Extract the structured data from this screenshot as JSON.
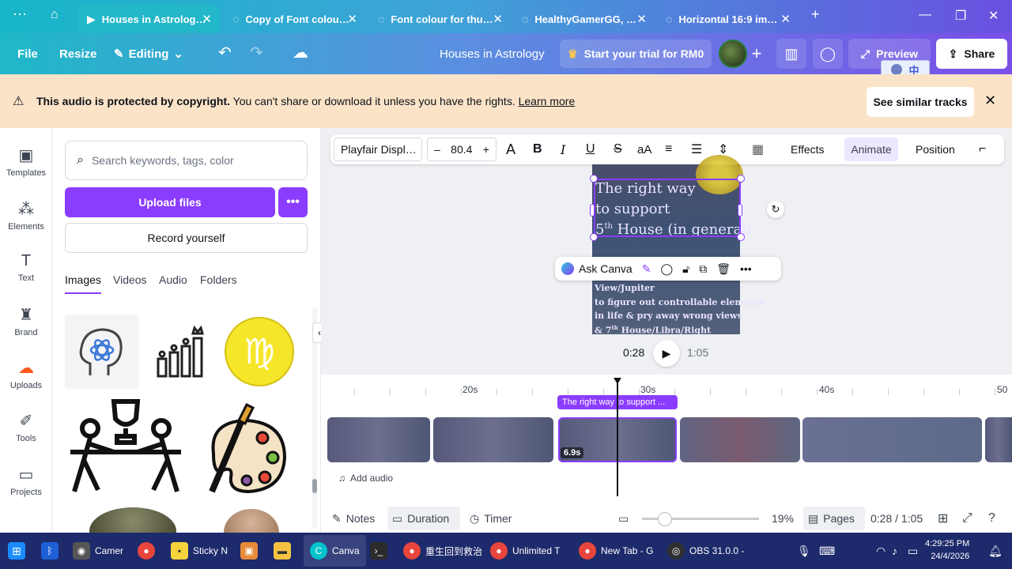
{
  "browser": {
    "tabs": [
      {
        "label": "Houses in Astrolog…",
        "active": true
      },
      {
        "label": "Copy of Font colou…",
        "active": false
      },
      {
        "label": "Font colour for thu…",
        "active": false
      },
      {
        "label": "HealthyGamerGG, …",
        "active": false
      },
      {
        "label": "Horizontal 16:9 im…",
        "active": false
      }
    ],
    "new_tab": "+"
  },
  "header": {
    "file": "File",
    "resize": "Resize",
    "editing": "Editing",
    "doc_title": "Houses in Astrology",
    "trial": "Start your trial for RM0",
    "preview": "Preview",
    "share": "Share",
    "ime_glyph": "中"
  },
  "banner": {
    "bold": "This audio is protected by copyright.",
    "text": " You can't share or download it unless you have the rights. ",
    "link": "Learn more",
    "similar": "See similar tracks"
  },
  "rail": [
    {
      "label": "Templates",
      "icon": "templates-icon"
    },
    {
      "label": "Elements",
      "icon": "elements-icon"
    },
    {
      "label": "Text",
      "icon": "text-icon"
    },
    {
      "label": "Brand",
      "icon": "brand-icon"
    },
    {
      "label": "Uploads",
      "icon": "uploads-icon",
      "selected": true
    },
    {
      "label": "Tools",
      "icon": "tools-icon"
    },
    {
      "label": "Projects",
      "icon": "projects-icon"
    }
  ],
  "panel": {
    "search_placeholder": "Search keywords, tags, color",
    "upload": "Upload files",
    "record": "Record yourself",
    "tabs": [
      "Images",
      "Videos",
      "Audio",
      "Folders"
    ]
  },
  "toolbar": {
    "font": "Playfair Displ…",
    "minus": "–",
    "size": "80.4",
    "plus": "+",
    "effects": "Effects",
    "animate": "Animate",
    "position": "Position"
  },
  "canvas": {
    "line1": "The right way",
    "line2": "to support",
    "line3_num": "5",
    "line3_sup": "th",
    "line3_rest": " House (in general)",
    "lower1": "View/Jupiter",
    "lower2": "to figure out controllable elements",
    "lower3": "in life & pry away wrong views",
    "lower4_num": "& 7",
    "lower4_sup": "th",
    "lower4_rest": " House/Libra/Right",
    "ask": "Ask Canva"
  },
  "playback": {
    "current": "0:28",
    "total": "1:05"
  },
  "timeline": {
    "marks": [
      "20s",
      "30s",
      "40s",
      "50"
    ],
    "text_clip": "The right way to support ...",
    "clip_duration": "6.9s",
    "add_audio": "Add audio"
  },
  "bottom": {
    "notes": "Notes",
    "duration": "Duration",
    "timer": "Timer",
    "zoom": "19%",
    "pages": "Pages",
    "time": "0:28 / 1:05",
    "zoom_level": 0.19
  },
  "taskbar": {
    "items": [
      "Camer",
      "Sticky N",
      "Canva",
      "重生回到救治",
      "Unlimited T",
      "New Tab - G",
      "OBS 31.0.0 -"
    ],
    "time": "4:29:25 PM",
    "date": "24/4/2026"
  },
  "colors": {
    "accent": "#8b3dff",
    "banner": "#fbe3c8",
    "uploads": "#ff5a1f"
  }
}
